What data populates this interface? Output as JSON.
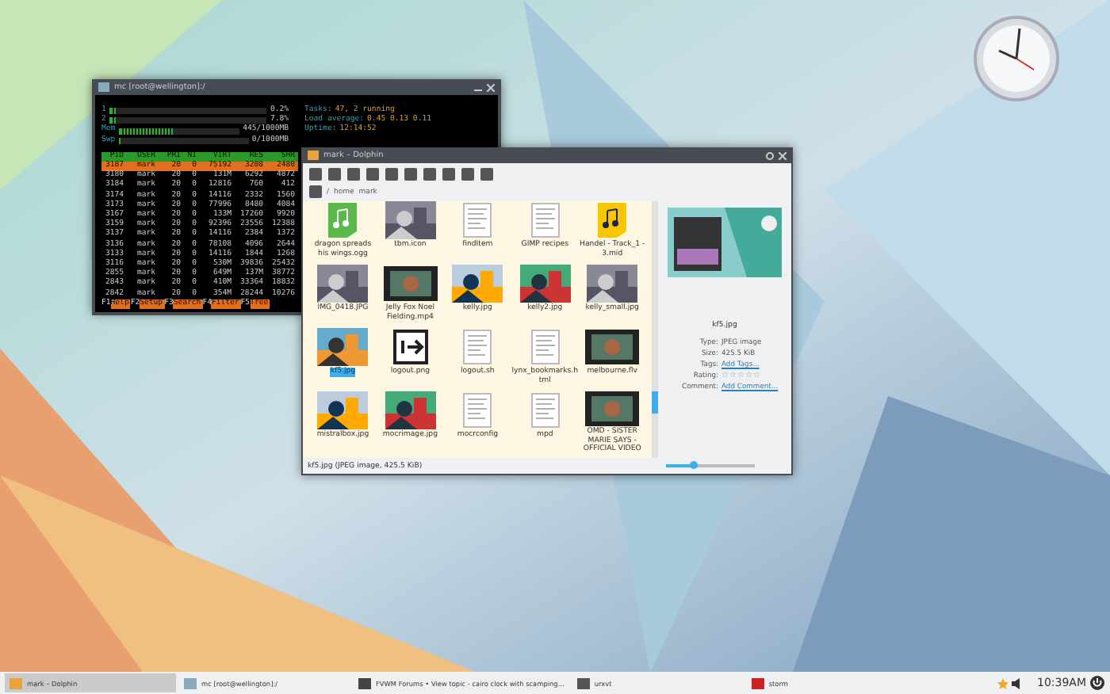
{
  "terminal": {
    "title": "mc [root@wellington]:/",
    "meters": [
      {
        "label": "1",
        "level": 0.04,
        "reading": "0.2%"
      },
      {
        "label": "2",
        "level": 0.04,
        "reading": "7.8%"
      },
      {
        "label": "Mem",
        "level": 0.45,
        "reading": "445/1000MB"
      },
      {
        "label": "Swp",
        "level": 0,
        "reading": "0/1000MB"
      }
    ],
    "summary": [
      {
        "label": "Tasks:",
        "value": "47, 2 running"
      },
      {
        "label": "Load average:",
        "value": "0.45 0.13 0.11"
      },
      {
        "label": "Uptime:",
        "value": "12:14:52"
      }
    ],
    "columns": [
      "PID",
      "USER",
      "PRI",
      "NI",
      "VIRT",
      "RES",
      "SHR"
    ],
    "rows": [
      {
        "cells": [
          "3187",
          "mark",
          "20",
          "0",
          "75192",
          "3208",
          "2480"
        ],
        "selected": true
      },
      {
        "cells": [
          "3180",
          "mark",
          "20",
          "0",
          "131M",
          "6292",
          "4872"
        ],
        "selected": false
      },
      {
        "cells": [
          "3184",
          "mark",
          "20",
          "0",
          "12816",
          "760",
          "412"
        ],
        "selected": false
      },
      {
        "cells": [
          "3174",
          "mark",
          "20",
          "0",
          "14116",
          "2332",
          "1560"
        ],
        "selected": false
      },
      {
        "cells": [
          "3173",
          "mark",
          "20",
          "0",
          "77996",
          "8480",
          "4084"
        ],
        "selected": false
      },
      {
        "cells": [
          "3167",
          "mark",
          "20",
          "0",
          "133M",
          "17260",
          "9920"
        ],
        "selected": false
      },
      {
        "cells": [
          "3159",
          "mark",
          "20",
          "0",
          "92396",
          "23556",
          "12388"
        ],
        "selected": false
      },
      {
        "cells": [
          "3137",
          "mark",
          "20",
          "0",
          "14116",
          "2384",
          "1372"
        ],
        "selected": false
      },
      {
        "cells": [
          "3136",
          "mark",
          "20",
          "0",
          "78108",
          "4096",
          "2644"
        ],
        "selected": false
      },
      {
        "cells": [
          "3133",
          "mark",
          "20",
          "0",
          "14116",
          "1844",
          "1268"
        ],
        "selected": false
      },
      {
        "cells": [
          "3116",
          "mark",
          "20",
          "0",
          "530M",
          "39836",
          "25432"
        ],
        "selected": false
      },
      {
        "cells": [
          "2855",
          "mark",
          "20",
          "0",
          "649M",
          "137M",
          "38772"
        ],
        "selected": false
      },
      {
        "cells": [
          "2843",
          "mark",
          "20",
          "0",
          "410M",
          "33364",
          "18832"
        ],
        "selected": false
      },
      {
        "cells": [
          "2842",
          "mark",
          "20",
          "0",
          "354M",
          "28244",
          "10276"
        ],
        "selected": false
      }
    ],
    "function_keys": [
      {
        "key": "F1",
        "label": "Help"
      },
      {
        "key": "F2",
        "label": "Setup"
      },
      {
        "key": "F3",
        "label": "Search"
      },
      {
        "key": "F4",
        "label": "Filter"
      },
      {
        "key": "F5",
        "label": "Tree"
      }
    ]
  },
  "dolphin": {
    "title": "mark – Dolphin",
    "breadcrumb": [
      "/",
      "home",
      "mark"
    ],
    "files": [
      {
        "name": "dragon spreads his wings.ogg",
        "kind": "audio",
        "selected": false
      },
      {
        "name": "tbm.icon",
        "kind": "picture",
        "selected": false
      },
      {
        "name": "findItem",
        "kind": "document",
        "selected": false
      },
      {
        "name": "GIMP recipes",
        "kind": "document",
        "selected": false
      },
      {
        "name": "Handel - Track_1 - 3.mid",
        "kind": "music",
        "selected": false
      },
      {
        "name": "IMG_0418.JPG",
        "kind": "picture",
        "selected": false
      },
      {
        "name": "Jelly Fox Noel Fielding.mp4",
        "kind": "video",
        "selected": false
      },
      {
        "name": "kelly.jpg",
        "kind": "picture",
        "selected": false
      },
      {
        "name": "kelly2.jpg",
        "kind": "picture",
        "selected": false
      },
      {
        "name": "kelly_small.jpg",
        "kind": "picture",
        "selected": false
      },
      {
        "name": "kf5.jpg",
        "kind": "picture",
        "selected": true
      },
      {
        "name": "logout.png",
        "kind": "logout",
        "selected": false
      },
      {
        "name": "logout.sh",
        "kind": "document",
        "selected": false
      },
      {
        "name": "lynx_bookmarks.html",
        "kind": "document",
        "selected": false
      },
      {
        "name": "melbourne.flv",
        "kind": "video",
        "selected": false
      },
      {
        "name": "mistralbox.jpg",
        "kind": "picture",
        "selected": false
      },
      {
        "name": "mocrimage.jpg",
        "kind": "picture",
        "selected": false
      },
      {
        "name": "mocrconfig",
        "kind": "document",
        "selected": false
      },
      {
        "name": "mpd",
        "kind": "document",
        "selected": false
      },
      {
        "name": "OMD - SISTER MARIE SAYS - OFFICIAL VIDEO",
        "kind": "video",
        "selected": false
      }
    ],
    "info": {
      "name": "kf5.jpg",
      "fields": [
        {
          "label": "Type:",
          "value": "JPEG image",
          "kind": "text"
        },
        {
          "label": "Size:",
          "value": "425.5 KiB",
          "kind": "text"
        },
        {
          "label": "Tags:",
          "value": "Add Tags...",
          "kind": "link"
        },
        {
          "label": "Rating:",
          "stars": 0,
          "kind": "rating"
        },
        {
          "label": "Comment:",
          "value": "Add Comment...",
          "kind": "link"
        }
      ]
    },
    "status": "kf5.jpg (JPEG image, 425.5 KiB)",
    "zoom": {
      "level": 0.3
    }
  },
  "taskbar": {
    "tasks": [
      {
        "label": "mark – Dolphin",
        "selected": true
      },
      {
        "label": "mc [root@wellington]:/",
        "selected": false
      },
      {
        "label": "FVWM Forums • View topic - cairo clock with scamping...",
        "selected": false
      },
      {
        "label": "urxvt",
        "selected": false
      },
      {
        "label": "storm",
        "selected": false
      }
    ],
    "time": "10:39AM"
  }
}
